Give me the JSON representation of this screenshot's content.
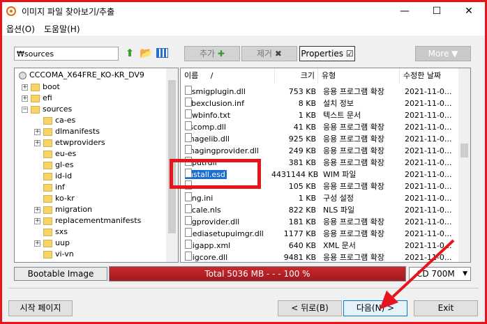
{
  "window": {
    "title": "이미지 파일 찾아보기/추출",
    "minimize": "—",
    "maximize": "☐",
    "close": "✕"
  },
  "menu": {
    "options": "옵션(O)",
    "help": "도움말(H)"
  },
  "toolbar": {
    "path": "₩sources",
    "add_label": "추가",
    "remove_label": "제거",
    "properties_label": "Properties",
    "more_label": "More ▼"
  },
  "tree": {
    "root": "CCCOMA_X64FRE_KO-KR_DV9",
    "items": [
      {
        "label": "boot",
        "expander": "+"
      },
      {
        "label": "efi",
        "expander": "+"
      },
      {
        "label": "sources",
        "expander": "−"
      },
      {
        "label": "ca-es",
        "expander": ""
      },
      {
        "label": "dlmanifests",
        "expander": "+"
      },
      {
        "label": "etwproviders",
        "expander": "+"
      },
      {
        "label": "eu-es",
        "expander": ""
      },
      {
        "label": "gl-es",
        "expander": ""
      },
      {
        "label": "id-id",
        "expander": ""
      },
      {
        "label": "inf",
        "expander": ""
      },
      {
        "label": "ko-kr",
        "expander": ""
      },
      {
        "label": "migration",
        "expander": "+"
      },
      {
        "label": "replacementmanifests",
        "expander": "+"
      },
      {
        "label": "sxs",
        "expander": ""
      },
      {
        "label": "uup",
        "expander": "+"
      },
      {
        "label": "vi-vn",
        "expander": ""
      }
    ]
  },
  "files": {
    "columns": {
      "name": "이름",
      "sort": "/",
      "size": "크기",
      "type": "유형",
      "date": "수정한 날짜"
    },
    "rows": [
      {
        "name": "iasmigplugin.dll",
        "size": "753 KB",
        "type": "응용 프로그램 확장",
        "date": "2021-11-0..."
      },
      {
        "name": "icbexclusion.inf",
        "size": "8 KB",
        "type": "설치 정보",
        "date": "2021-11-0..."
      },
      {
        "name": "idwbinfo.txt",
        "size": "1 KB",
        "type": "텍스트 문서",
        "date": "2021-11-0..."
      },
      {
        "name": "iiscomp.dll",
        "size": "41 KB",
        "type": "응용 프로그램 확장",
        "date": "2021-11-0..."
      },
      {
        "name": "imagelib.dll",
        "size": "925 KB",
        "type": "응용 프로그램 확장",
        "date": "2021-11-0..."
      },
      {
        "name": "imagingprovider.dll",
        "size": "249 KB",
        "type": "응용 프로그램 확장",
        "date": "2021-11-0..."
      },
      {
        "name": "inputrdll",
        "size": "381 KB",
        "type": "응용 프로그램 확장",
        "date": "2021-11-0..."
      },
      {
        "name": "install.esd",
        "size": "4431144 KB",
        "type": "WIM 파일",
        "date": "2021-11-0..."
      },
      {
        "name": "...",
        "size": "105 KB",
        "type": "응용 프로그램 확장",
        "date": "2021-11-0..."
      },
      {
        "name": "lang.ini",
        "size": "1 KB",
        "type": "구성 설정",
        "date": "2021-11-0..."
      },
      {
        "name": "locale.nls",
        "size": "822 KB",
        "type": "NLS 파일",
        "date": "2021-11-0..."
      },
      {
        "name": "logprovider.dll",
        "size": "181 KB",
        "type": "응용 프로그램 확장",
        "date": "2021-11-0..."
      },
      {
        "name": "mediasetupuimgr.dll",
        "size": "1177 KB",
        "type": "응용 프로그램 확장",
        "date": "2021-11-0..."
      },
      {
        "name": "migapp.xml",
        "size": "640 KB",
        "type": "XML 문서",
        "date": "2021-11-0..."
      },
      {
        "name": "migcore.dll",
        "size": "9481 KB",
        "type": "응용 프로그램 확장",
        "date": "2021-11-0..."
      }
    ]
  },
  "status": {
    "bootable": "Bootable Image",
    "usage_text": "Total  5036 MB   - - -  100 %",
    "usage_percent": 100,
    "disc_type": "CD 700M"
  },
  "buttons": {
    "start": "시작 페이지",
    "back": "< 뒤로(B)",
    "next": "다음(N) >",
    "exit": "Exit"
  },
  "colors": {
    "annotation_red": "#e8141c",
    "selection": "#1b6fd3",
    "usage_bar": "#b52226"
  }
}
